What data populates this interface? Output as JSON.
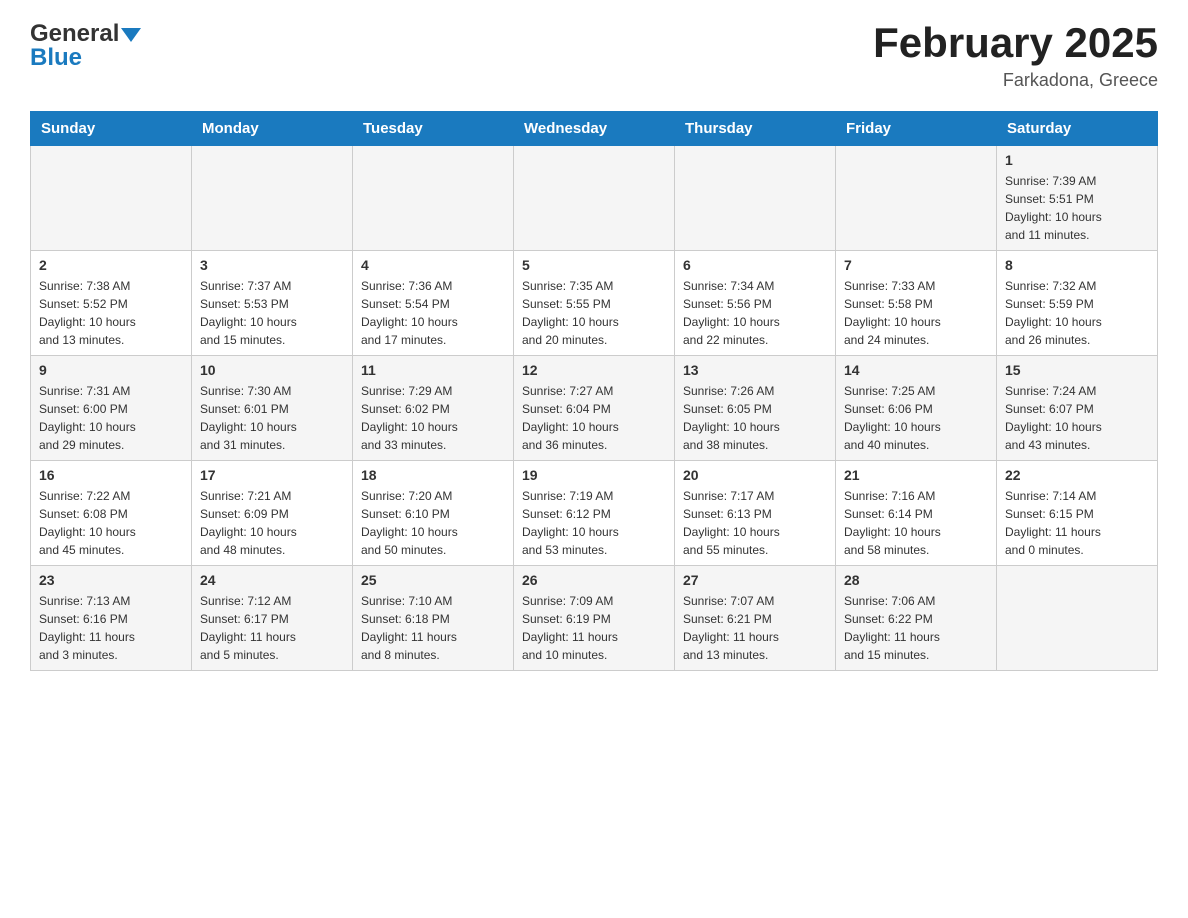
{
  "header": {
    "logo_general": "General",
    "logo_blue": "Blue",
    "month_title": "February 2025",
    "location": "Farkadona, Greece"
  },
  "weekdays": [
    "Sunday",
    "Monday",
    "Tuesday",
    "Wednesday",
    "Thursday",
    "Friday",
    "Saturday"
  ],
  "weeks": [
    [
      {
        "day": "",
        "info": ""
      },
      {
        "day": "",
        "info": ""
      },
      {
        "day": "",
        "info": ""
      },
      {
        "day": "",
        "info": ""
      },
      {
        "day": "",
        "info": ""
      },
      {
        "day": "",
        "info": ""
      },
      {
        "day": "1",
        "info": "Sunrise: 7:39 AM\nSunset: 5:51 PM\nDaylight: 10 hours\nand 11 minutes."
      }
    ],
    [
      {
        "day": "2",
        "info": "Sunrise: 7:38 AM\nSunset: 5:52 PM\nDaylight: 10 hours\nand 13 minutes."
      },
      {
        "day": "3",
        "info": "Sunrise: 7:37 AM\nSunset: 5:53 PM\nDaylight: 10 hours\nand 15 minutes."
      },
      {
        "day": "4",
        "info": "Sunrise: 7:36 AM\nSunset: 5:54 PM\nDaylight: 10 hours\nand 17 minutes."
      },
      {
        "day": "5",
        "info": "Sunrise: 7:35 AM\nSunset: 5:55 PM\nDaylight: 10 hours\nand 20 minutes."
      },
      {
        "day": "6",
        "info": "Sunrise: 7:34 AM\nSunset: 5:56 PM\nDaylight: 10 hours\nand 22 minutes."
      },
      {
        "day": "7",
        "info": "Sunrise: 7:33 AM\nSunset: 5:58 PM\nDaylight: 10 hours\nand 24 minutes."
      },
      {
        "day": "8",
        "info": "Sunrise: 7:32 AM\nSunset: 5:59 PM\nDaylight: 10 hours\nand 26 minutes."
      }
    ],
    [
      {
        "day": "9",
        "info": "Sunrise: 7:31 AM\nSunset: 6:00 PM\nDaylight: 10 hours\nand 29 minutes."
      },
      {
        "day": "10",
        "info": "Sunrise: 7:30 AM\nSunset: 6:01 PM\nDaylight: 10 hours\nand 31 minutes."
      },
      {
        "day": "11",
        "info": "Sunrise: 7:29 AM\nSunset: 6:02 PM\nDaylight: 10 hours\nand 33 minutes."
      },
      {
        "day": "12",
        "info": "Sunrise: 7:27 AM\nSunset: 6:04 PM\nDaylight: 10 hours\nand 36 minutes."
      },
      {
        "day": "13",
        "info": "Sunrise: 7:26 AM\nSunset: 6:05 PM\nDaylight: 10 hours\nand 38 minutes."
      },
      {
        "day": "14",
        "info": "Sunrise: 7:25 AM\nSunset: 6:06 PM\nDaylight: 10 hours\nand 40 minutes."
      },
      {
        "day": "15",
        "info": "Sunrise: 7:24 AM\nSunset: 6:07 PM\nDaylight: 10 hours\nand 43 minutes."
      }
    ],
    [
      {
        "day": "16",
        "info": "Sunrise: 7:22 AM\nSunset: 6:08 PM\nDaylight: 10 hours\nand 45 minutes."
      },
      {
        "day": "17",
        "info": "Sunrise: 7:21 AM\nSunset: 6:09 PM\nDaylight: 10 hours\nand 48 minutes."
      },
      {
        "day": "18",
        "info": "Sunrise: 7:20 AM\nSunset: 6:10 PM\nDaylight: 10 hours\nand 50 minutes."
      },
      {
        "day": "19",
        "info": "Sunrise: 7:19 AM\nSunset: 6:12 PM\nDaylight: 10 hours\nand 53 minutes."
      },
      {
        "day": "20",
        "info": "Sunrise: 7:17 AM\nSunset: 6:13 PM\nDaylight: 10 hours\nand 55 minutes."
      },
      {
        "day": "21",
        "info": "Sunrise: 7:16 AM\nSunset: 6:14 PM\nDaylight: 10 hours\nand 58 minutes."
      },
      {
        "day": "22",
        "info": "Sunrise: 7:14 AM\nSunset: 6:15 PM\nDaylight: 11 hours\nand 0 minutes."
      }
    ],
    [
      {
        "day": "23",
        "info": "Sunrise: 7:13 AM\nSunset: 6:16 PM\nDaylight: 11 hours\nand 3 minutes."
      },
      {
        "day": "24",
        "info": "Sunrise: 7:12 AM\nSunset: 6:17 PM\nDaylight: 11 hours\nand 5 minutes."
      },
      {
        "day": "25",
        "info": "Sunrise: 7:10 AM\nSunset: 6:18 PM\nDaylight: 11 hours\nand 8 minutes."
      },
      {
        "day": "26",
        "info": "Sunrise: 7:09 AM\nSunset: 6:19 PM\nDaylight: 11 hours\nand 10 minutes."
      },
      {
        "day": "27",
        "info": "Sunrise: 7:07 AM\nSunset: 6:21 PM\nDaylight: 11 hours\nand 13 minutes."
      },
      {
        "day": "28",
        "info": "Sunrise: 7:06 AM\nSunset: 6:22 PM\nDaylight: 11 hours\nand 15 minutes."
      },
      {
        "day": "",
        "info": ""
      }
    ]
  ]
}
